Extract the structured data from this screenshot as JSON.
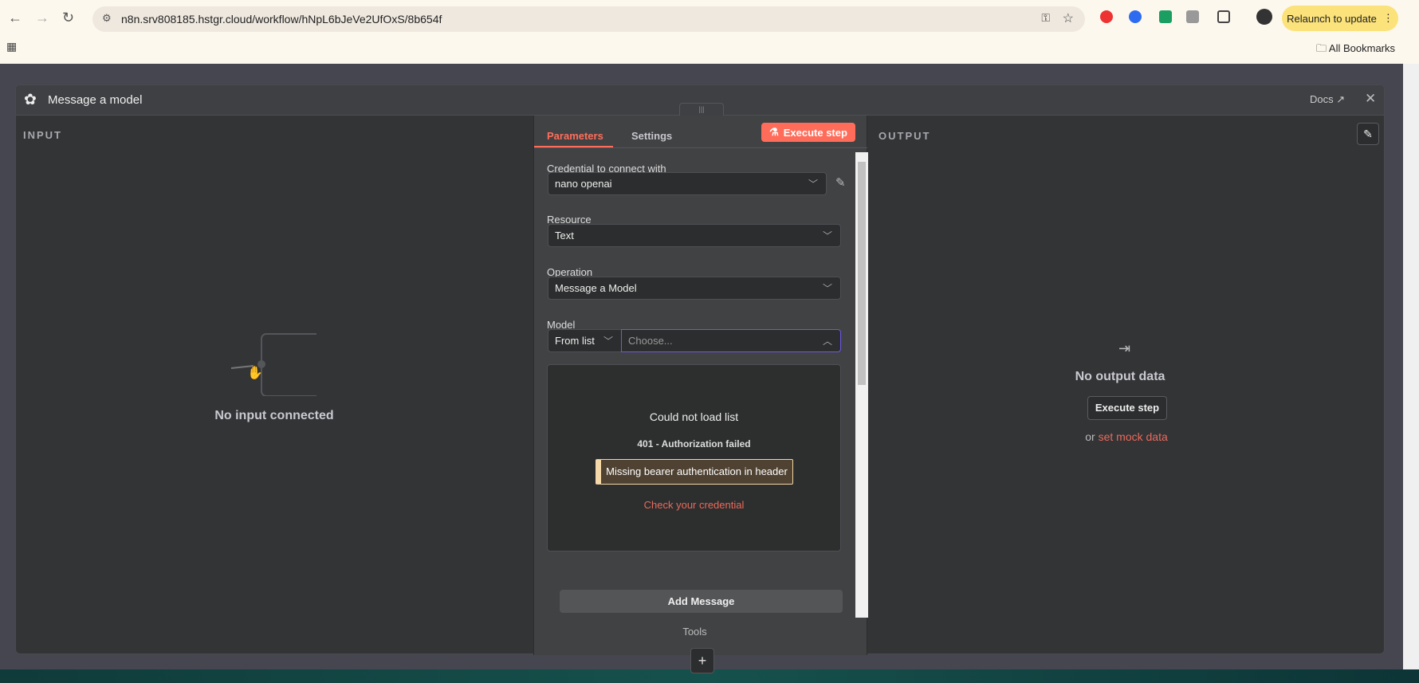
{
  "browser": {
    "url": "n8n.srv808185.hstgr.cloud/workflow/hNpL6bJeVe2UfOxS/8b654f",
    "relaunch_label": "Relaunch to update",
    "bookmarks_label": "All Bookmarks"
  },
  "modal": {
    "title": "Message a model",
    "docs_label": "Docs"
  },
  "input": {
    "label": "INPUT",
    "empty_text": "No input connected"
  },
  "params": {
    "tabs": [
      {
        "label": "Parameters",
        "active": true
      },
      {
        "label": "Settings",
        "active": false
      }
    ],
    "execute_label": "Execute step",
    "credential": {
      "label": "Credential to connect with",
      "value": "nano openai"
    },
    "resource": {
      "label": "Resource",
      "value": "Text"
    },
    "operation": {
      "label": "Operation",
      "value": "Message a Model"
    },
    "model": {
      "label": "Model",
      "mode": "From list",
      "placeholder": "Choose..."
    },
    "error": {
      "title": "Could not load list",
      "code": "401 - Authorization failed",
      "detail": "Missing bearer authentication in header",
      "link": "Check your credential"
    },
    "add_message_label": "Add Message",
    "tools_label": "Tools"
  },
  "output": {
    "label": "OUTPUT",
    "empty_text": "No output data",
    "execute_label": "Execute step",
    "or_text": "or",
    "mock_link": "set mock data"
  },
  "colors": {
    "accent": "#ff6d5a",
    "panel": "#333436",
    "warning": "#f6d9a8"
  }
}
